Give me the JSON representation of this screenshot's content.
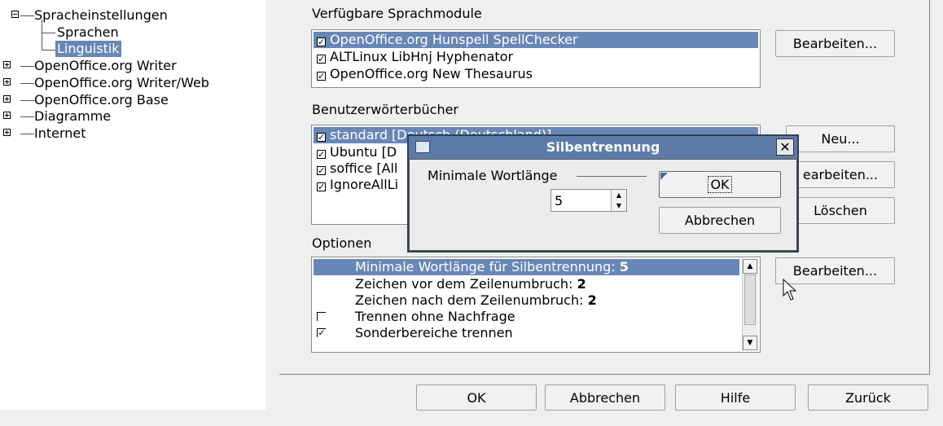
{
  "tree": {
    "items": [
      {
        "label": "Spracheinstellungen",
        "expander": "minus"
      },
      {
        "label": "Sprachen"
      },
      {
        "label": "Linguistik",
        "selected": true
      },
      {
        "label": "OpenOffice.org Writer",
        "expander": "plus"
      },
      {
        "label": "OpenOffice.org Writer/Web",
        "expander": "plus"
      },
      {
        "label": "OpenOffice.org Base",
        "expander": "plus"
      },
      {
        "label": "Diagramme",
        "expander": "plus"
      },
      {
        "label": "Internet",
        "expander": "plus"
      }
    ]
  },
  "modules": {
    "heading": "Verfügbare Sprachmodule",
    "items": [
      {
        "label": "OpenOffice.org Hunspell SpellChecker",
        "checked": true,
        "selected": true
      },
      {
        "label": "ALTLinux LibHnj Hyphenator",
        "checked": true
      },
      {
        "label": "OpenOffice.org New Thesaurus",
        "checked": true
      }
    ],
    "edit_button": "Bearbeiten..."
  },
  "dictionaries": {
    "heading": "Benutzerwörterbücher",
    "items": [
      {
        "label": "standard [Deutsch (Deutschland)]",
        "checked": true,
        "selected": true
      },
      {
        "label": "Ubuntu [D",
        "checked": true
      },
      {
        "label": "soffice [All",
        "checked": true
      },
      {
        "label": "IgnoreAllLi",
        "checked": true
      }
    ],
    "new_button": "Neu...",
    "edit_button": "earbeiten...",
    "delete_button": "Löschen"
  },
  "options": {
    "heading": "Optionen",
    "items": [
      {
        "label": "Minimale Wortlänge für Silbentrennung:",
        "value": "5",
        "selected": true
      },
      {
        "label": "Zeichen vor dem Zeilenumbruch:",
        "value": "2"
      },
      {
        "label": "Zeichen nach dem Zeilenumbruch:",
        "value": "2"
      },
      {
        "label": "Trennen ohne Nachfrage",
        "checked": false,
        "checkbox": true
      },
      {
        "label": "Sonderbereiche trennen",
        "checked": true,
        "checkbox": true
      }
    ],
    "edit_button": "Bearbeiten..."
  },
  "footer": {
    "ok": "OK",
    "cancel": "Abbrechen",
    "help": "Hilfe",
    "back": "Zurück"
  },
  "dialog": {
    "title": "Silbentrennung",
    "close_symbol": "✕",
    "group_label": "Minimale Wortlänge",
    "spin_value": "5",
    "ok": "OK",
    "cancel": "Abbrechen"
  },
  "colors": {
    "selection": "#6887b6",
    "titlebar": "#5c7ba8"
  }
}
